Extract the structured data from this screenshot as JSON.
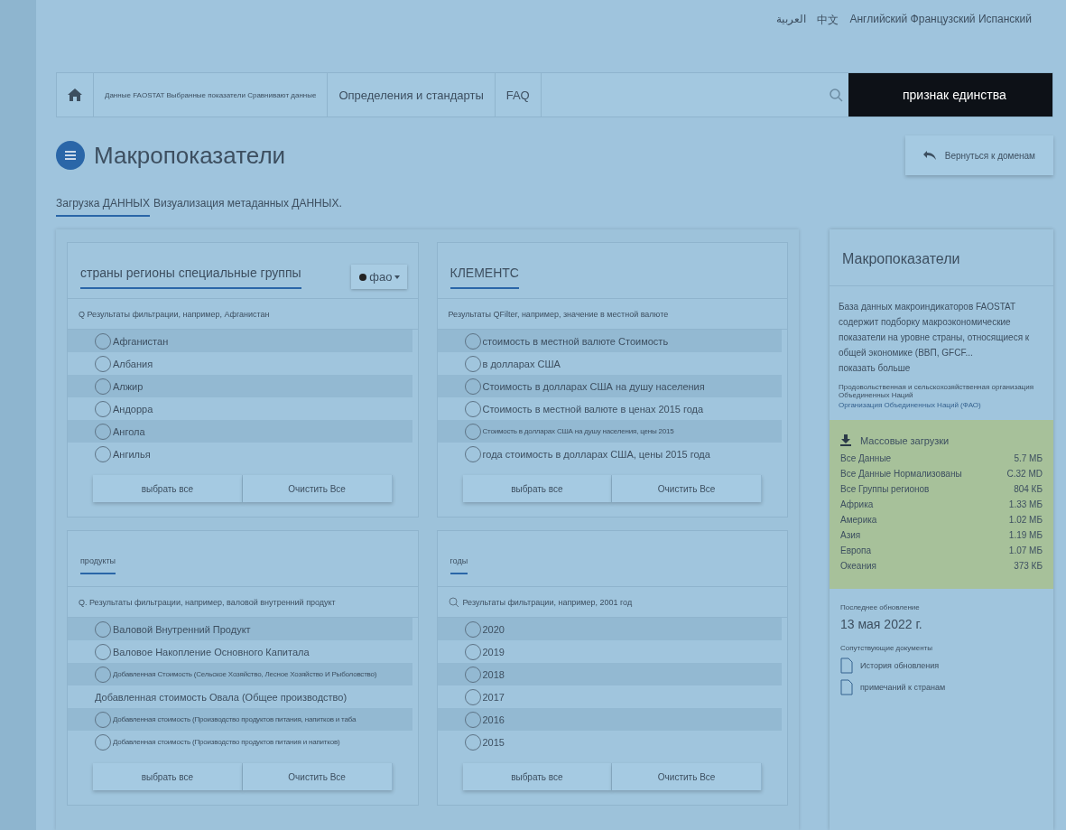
{
  "languages": [
    "العربية",
    "中文",
    "Английский Французский Испанский"
  ],
  "nav": {
    "items": [
      "Данные FAOSTAT Выбранные показатели Сравнивают данные",
      "Определения и стандарты",
      "FAQ"
    ],
    "search_value": "признак единства"
  },
  "title": "Макропоказатели",
  "back_button": "Вернуться к доменам",
  "tabs": [
    {
      "label": "Загрузка ДАННЫХ",
      "selected": true
    },
    {
      "label": "Визуализация метаданных ДАННЫХ.",
      "selected": false
    }
  ],
  "cards": [
    {
      "title": "страны регионы специальные группы",
      "menu": "фао",
      "filter": "Q Результаты фильтрации, например, Афганистан",
      "items": [
        {
          "kind": "radio",
          "label": "Афганистан",
          "selected": false
        },
        {
          "kind": "radio",
          "label": "Албания",
          "selected": false
        },
        {
          "kind": "radio",
          "label": "Алжир",
          "selected": false
        },
        {
          "kind": "radio",
          "label": "Андорра",
          "selected": false
        },
        {
          "kind": "radio",
          "label": "Ангола",
          "selected": false
        },
        {
          "kind": "radio",
          "label": "Ангилья",
          "selected": false
        }
      ],
      "select_all": "выбрать все",
      "clear_all": "Очистить Все"
    },
    {
      "title": "КЛЕМЕНТС",
      "filter": "Результаты QFilter, например, значение в местной валюте",
      "items": [
        {
          "kind": "radio",
          "label": "стоимость в местной валюте Стоимость",
          "selected": false
        },
        {
          "kind": "radio",
          "label": "в долларах США",
          "selected": false
        },
        {
          "kind": "radio",
          "label": "Стоимость в долларах США на душу населения",
          "selected": false
        },
        {
          "kind": "radio",
          "label": "Стоимость в местной валюте в ценах 2015 года",
          "selected": false
        },
        {
          "kind": "radio",
          "label": "Стоимость в долларах США на душу населения, цены 2015",
          "selected": false
        },
        {
          "kind": "radio",
          "label": "года стоимость в долларах США, цены 2015 года",
          "selected": false
        }
      ],
      "select_all": "выбрать все",
      "clear_all": "Очистить Все"
    },
    {
      "title": "продукты",
      "filter": "Q. Результаты фильтрации, например, валовой внутренний продукт",
      "items": [
        {
          "kind": "radio",
          "label": "Валовой Внутренний Продукт",
          "selected": false
        },
        {
          "kind": "radio",
          "label": "Валовое Накопление Основного Капитала",
          "selected": false
        },
        {
          "kind": "radio",
          "label": "Добавленная Стоимость (Сельское Хозяйство, Лесное Хозяйство И Рыболовство)",
          "selected": false
        },
        {
          "kind": "text",
          "label": "Добавленная стоимость Овала (Общее производство)"
        },
        {
          "kind": "radio",
          "label": "Добавленная стоимость (Производство продуктов питания, напитков и табa",
          "selected": false
        },
        {
          "kind": "radio",
          "label": "Добавленная стоимость (Производство продуктов питания и напитков)",
          "selected": false
        }
      ],
      "select_all": "выбрать все",
      "clear_all": "Очистить Все"
    },
    {
      "title": "годы",
      "search_icon": true,
      "filter": "Результаты фильтрации, например, 2001 год",
      "items": [
        {
          "kind": "radio",
          "label": "2020",
          "selected": false
        },
        {
          "kind": "radio",
          "label": "2019",
          "selected": false
        },
        {
          "kind": "radio",
          "label": "2018",
          "selected": false
        },
        {
          "kind": "radio",
          "label": "2017",
          "selected": false
        },
        {
          "kind": "radio",
          "label": "2016",
          "selected": false
        },
        {
          "kind": "radio",
          "label": "2015",
          "selected": false
        }
      ],
      "select_all": "выбрать все",
      "clear_all": "Очистить Все"
    }
  ],
  "sidebar": {
    "title": "Макропоказатели",
    "description": "База данных макроиндикаторов FAOSTAT содержит подборку макроэкономические показатели на уровне страны, относящиеся к общей экономике (ВВП, GFCF...",
    "show_more": "показать больше",
    "source": "Продовольственная и сельскохозяйственная организация Объединенных Наций",
    "source_link": "Организация Объединенных Наций (ФАО)",
    "bulk_title": "Массовые загрузки",
    "downloads": [
      {
        "label": "Все Данные",
        "size": "5.7 МБ"
      },
      {
        "label": "Все Данные Нормализованы",
        "size": "С.32 МD"
      },
      {
        "label": "Все Группы регионов",
        "size": "804 КБ"
      },
      {
        "label": "Африка",
        "size": "1.33 МБ"
      },
      {
        "label": "Америка",
        "size": "1.02 МБ"
      },
      {
        "label": "Азия",
        "size": "1.19 МБ"
      },
      {
        "label": "Европа",
        "size": "1.07 МБ"
      },
      {
        "label": "Океания",
        "size": "373 КБ"
      }
    ],
    "updated_label": "Последнее обновление",
    "updated": "13 мая 2022 г.",
    "docs_label": "Сопутствующие документы",
    "docs": [
      "История обновления",
      "примечаний к странам"
    ]
  }
}
